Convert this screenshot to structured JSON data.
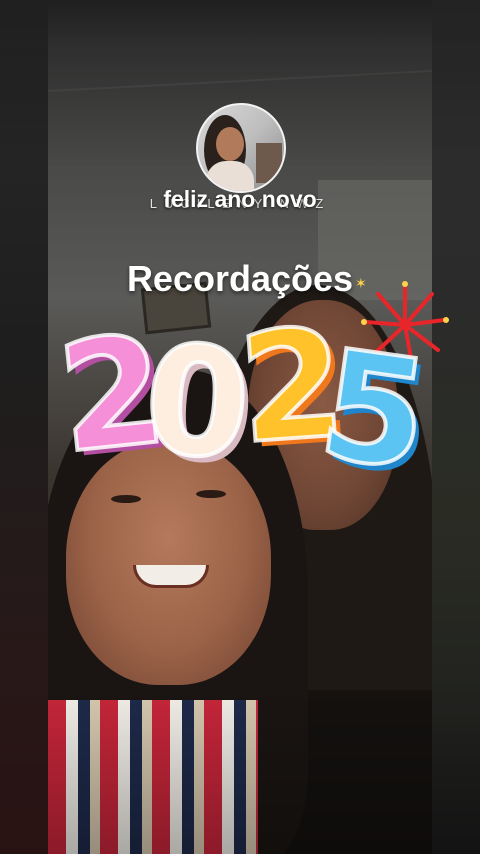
{
  "profile": {
    "username": "LUCILENY NWZ",
    "caption": "feliz ano novo"
  },
  "memory": {
    "title": "Recordações",
    "sticker_text": [
      "2",
      "0",
      "2",
      "5"
    ],
    "sticker_colors": [
      "#f48fd8",
      "#fdeee0",
      "#ffc22a",
      "#5cc4f2"
    ]
  },
  "icons": {
    "firework": "firework-icon",
    "sparkle": "sparkle-icon"
  }
}
